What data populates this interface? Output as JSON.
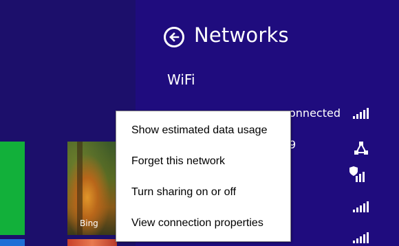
{
  "start_screen": {
    "bing_tile_label": "Bing",
    "colors": {
      "green_tile": "#12b03a",
      "background": "#1c0f6b"
    }
  },
  "charm": {
    "title": "Networks",
    "section_heading": "WiFi",
    "first_network_status": "onnected",
    "second_network_partial": "9",
    "colors": {
      "background": "#1f0c7e",
      "text": "#ffffff"
    }
  },
  "context_menu": {
    "items": [
      "Show estimated data usage",
      "Forget this network",
      "Turn sharing on or off",
      "View connection properties"
    ]
  },
  "icons": {
    "back": "back-arrow-circle-icon",
    "signal": "wifi-signal-icon",
    "network": "network-nodes-icon",
    "shield": "secured-shield-icon"
  }
}
